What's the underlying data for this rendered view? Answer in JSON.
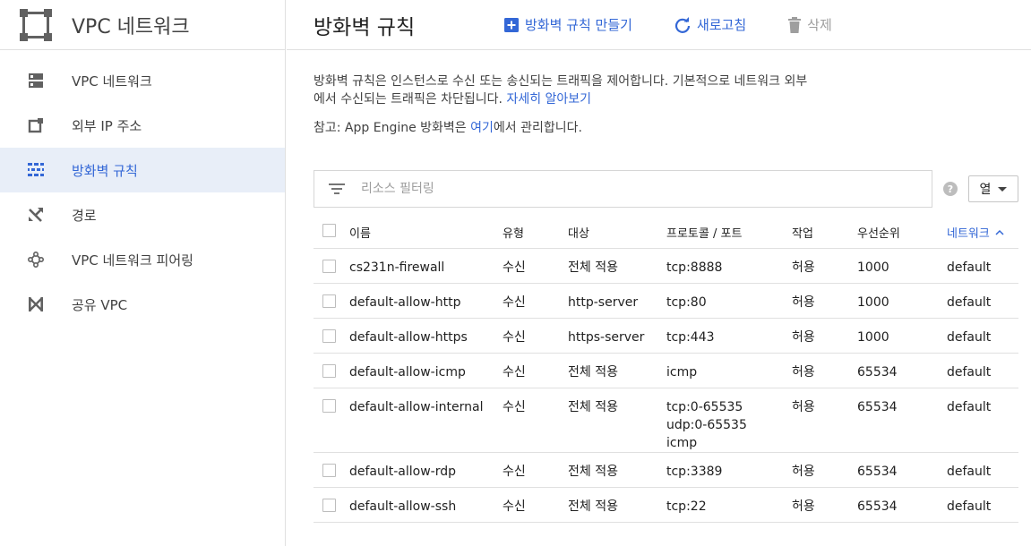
{
  "sidebar": {
    "product_title": "VPC 네트워크",
    "items": [
      {
        "label": "VPC 네트워크",
        "icon": "vpc-network-icon",
        "active": false
      },
      {
        "label": "외부 IP 주소",
        "icon": "external-ip-icon",
        "active": false
      },
      {
        "label": "방화벽 규칙",
        "icon": "firewall-icon",
        "active": true
      },
      {
        "label": "경로",
        "icon": "routes-icon",
        "active": false
      },
      {
        "label": "VPC 네트워크 피어링",
        "icon": "peering-icon",
        "active": false
      },
      {
        "label": "공유 VPC",
        "icon": "shared-vpc-icon",
        "active": false
      }
    ]
  },
  "header": {
    "title": "방화벽 규칙",
    "create_label": "방화벽 규칙 만들기",
    "refresh_label": "새로고침",
    "delete_label": "삭제"
  },
  "main": {
    "description_prefix": "방화벽 규칙은 인스턴스로 수신 또는 송신되는 트래픽을 제어합니다. 기본적으로 네트워크 외부에서 수신되는 트래픽은 차단됩니다. ",
    "learn_more": "자세히 알아보기",
    "note_prefix": "참고: App Engine 방화벽은 ",
    "note_link": "여기",
    "note_suffix": "에서 관리합니다.",
    "filter_placeholder": "리소스 필터링",
    "columns_button": "열"
  },
  "table": {
    "headers": {
      "name": "이름",
      "type": "유형",
      "target": "대상",
      "protocol": "프로토콜 / 포트",
      "action": "작업",
      "priority": "우선순위",
      "network": "네트워크"
    },
    "rows": [
      {
        "name": "cs231n-firewall",
        "type": "수신",
        "target": "전체 적용",
        "protocol": [
          "tcp:8888"
        ],
        "action": "허용",
        "priority": "1000",
        "network": "default"
      },
      {
        "name": "default-allow-http",
        "type": "수신",
        "target": "http-server",
        "protocol": [
          "tcp:80"
        ],
        "action": "허용",
        "priority": "1000",
        "network": "default"
      },
      {
        "name": "default-allow-https",
        "type": "수신",
        "target": "https-server",
        "protocol": [
          "tcp:443"
        ],
        "action": "허용",
        "priority": "1000",
        "network": "default"
      },
      {
        "name": "default-allow-icmp",
        "type": "수신",
        "target": "전체 적용",
        "protocol": [
          "icmp"
        ],
        "action": "허용",
        "priority": "65534",
        "network": "default"
      },
      {
        "name": "default-allow-internal",
        "type": "수신",
        "target": "전체 적용",
        "protocol": [
          "tcp:0-65535",
          "udp:0-65535",
          "icmp"
        ],
        "action": "허용",
        "priority": "65534",
        "network": "default"
      },
      {
        "name": "default-allow-rdp",
        "type": "수신",
        "target": "전체 적용",
        "protocol": [
          "tcp:3389"
        ],
        "action": "허용",
        "priority": "65534",
        "network": "default"
      },
      {
        "name": "default-allow-ssh",
        "type": "수신",
        "target": "전체 적용",
        "protocol": [
          "tcp:22"
        ],
        "action": "허용",
        "priority": "65534",
        "network": "default"
      }
    ]
  },
  "colors": {
    "accent": "#3367d6",
    "active_bg": "#e8eef8",
    "border": "#e0e0e0"
  }
}
